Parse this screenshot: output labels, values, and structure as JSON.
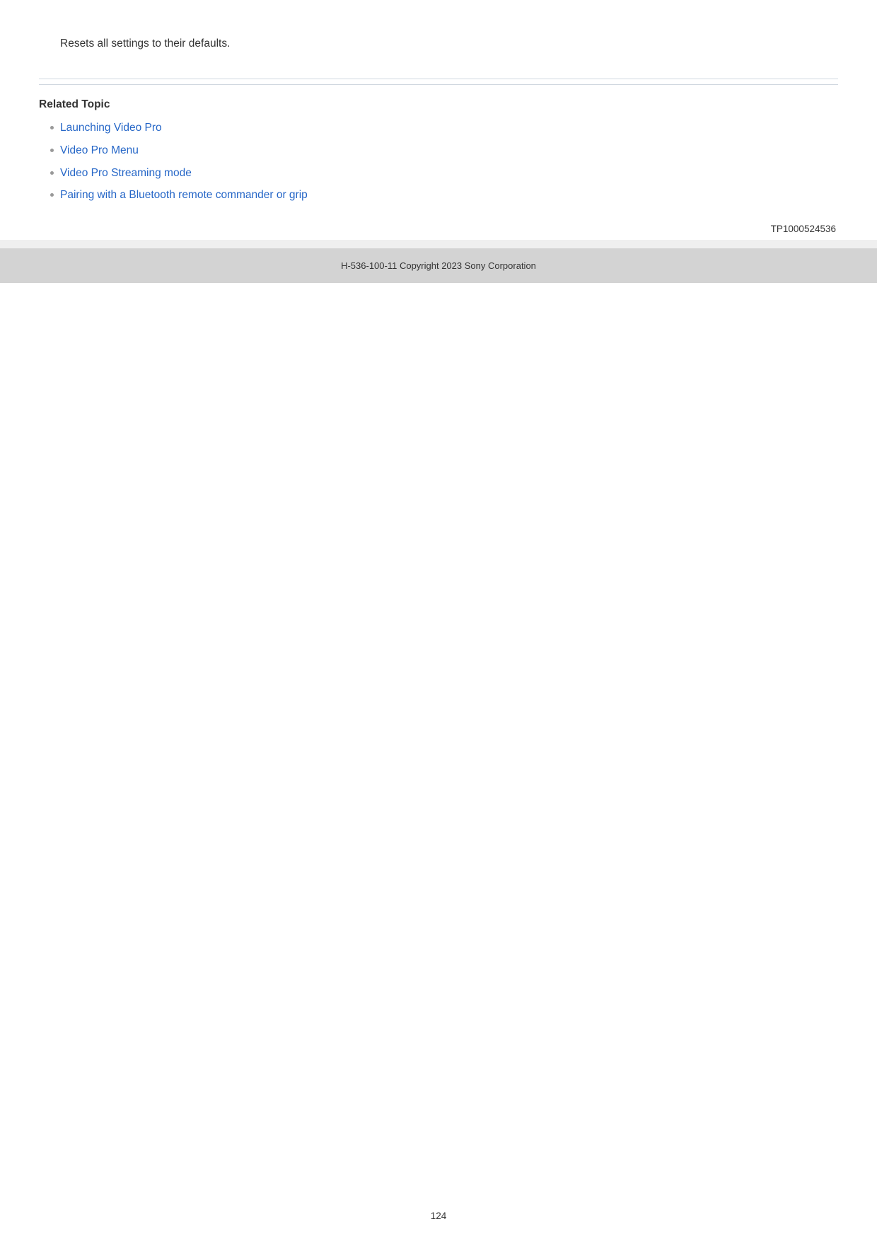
{
  "description": "Resets all settings to their defaults.",
  "related_topic": {
    "heading": "Related Topic",
    "links": [
      "Launching Video Pro",
      "Video Pro Menu",
      "Video Pro Streaming mode",
      "Pairing with a Bluetooth remote commander or grip"
    ]
  },
  "doc_id": "TP1000524536",
  "footer": "H-536-100-11 Copyright 2023 Sony Corporation",
  "page_number": "124"
}
